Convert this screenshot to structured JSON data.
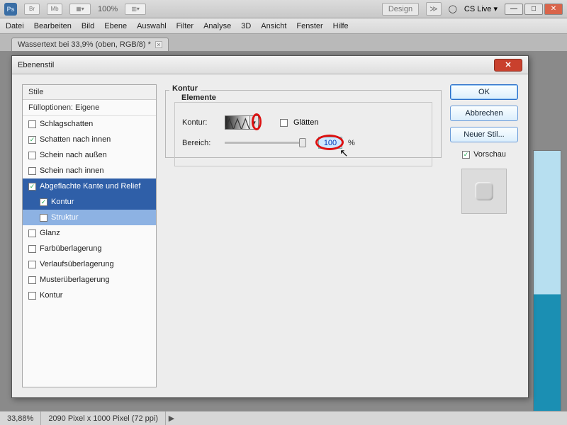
{
  "app": {
    "logo": "Ps",
    "zoom_label": "100%",
    "design_btn": "Design",
    "cslive_label": "CS Live ▾"
  },
  "toolbar_pills": [
    "Br",
    "Mb"
  ],
  "menu": [
    "Datei",
    "Bearbeiten",
    "Bild",
    "Ebene",
    "Auswahl",
    "Filter",
    "Analyse",
    "3D",
    "Ansicht",
    "Fenster",
    "Hilfe"
  ],
  "tab": {
    "title": "Wassertext bei 33,9% (oben, RGB/8) *"
  },
  "dialog": {
    "title": "Ebenenstil",
    "styles_header": "Stile",
    "fill_options": "Fülloptionen: Eigene",
    "items": [
      {
        "label": "Schlagschatten",
        "checked": false,
        "indent": false,
        "sel": ""
      },
      {
        "label": "Schatten nach innen",
        "checked": true,
        "indent": false,
        "sel": ""
      },
      {
        "label": "Schein nach außen",
        "checked": false,
        "indent": false,
        "sel": ""
      },
      {
        "label": "Schein nach innen",
        "checked": false,
        "indent": false,
        "sel": ""
      },
      {
        "label": "Abgeflachte Kante und Relief",
        "checked": true,
        "indent": false,
        "sel": "dark"
      },
      {
        "label": "Kontur",
        "checked": true,
        "indent": true,
        "sel": "dark"
      },
      {
        "label": "Struktur",
        "checked": false,
        "indent": true,
        "sel": "light"
      },
      {
        "label": "Glanz",
        "checked": false,
        "indent": false,
        "sel": ""
      },
      {
        "label": "Farbüberlagerung",
        "checked": false,
        "indent": false,
        "sel": ""
      },
      {
        "label": "Verlaufsüberlagerung",
        "checked": false,
        "indent": false,
        "sel": ""
      },
      {
        "label": "Musterüberlagerung",
        "checked": false,
        "indent": false,
        "sel": ""
      },
      {
        "label": "Kontur",
        "checked": false,
        "indent": false,
        "sel": ""
      }
    ],
    "group_title": "Kontur",
    "subgroup_title": "Elemente",
    "contour_label": "Kontur:",
    "smooth_label": "Glätten",
    "range_label": "Bereich:",
    "range_value": "100",
    "percent": "%",
    "ok": "OK",
    "cancel": "Abbrechen",
    "new_style": "Neuer Stil...",
    "preview": "Vorschau"
  },
  "status": {
    "zoom": "33,88%",
    "dims": "2090 Pixel x 1000 Pixel (72 ppi)"
  }
}
